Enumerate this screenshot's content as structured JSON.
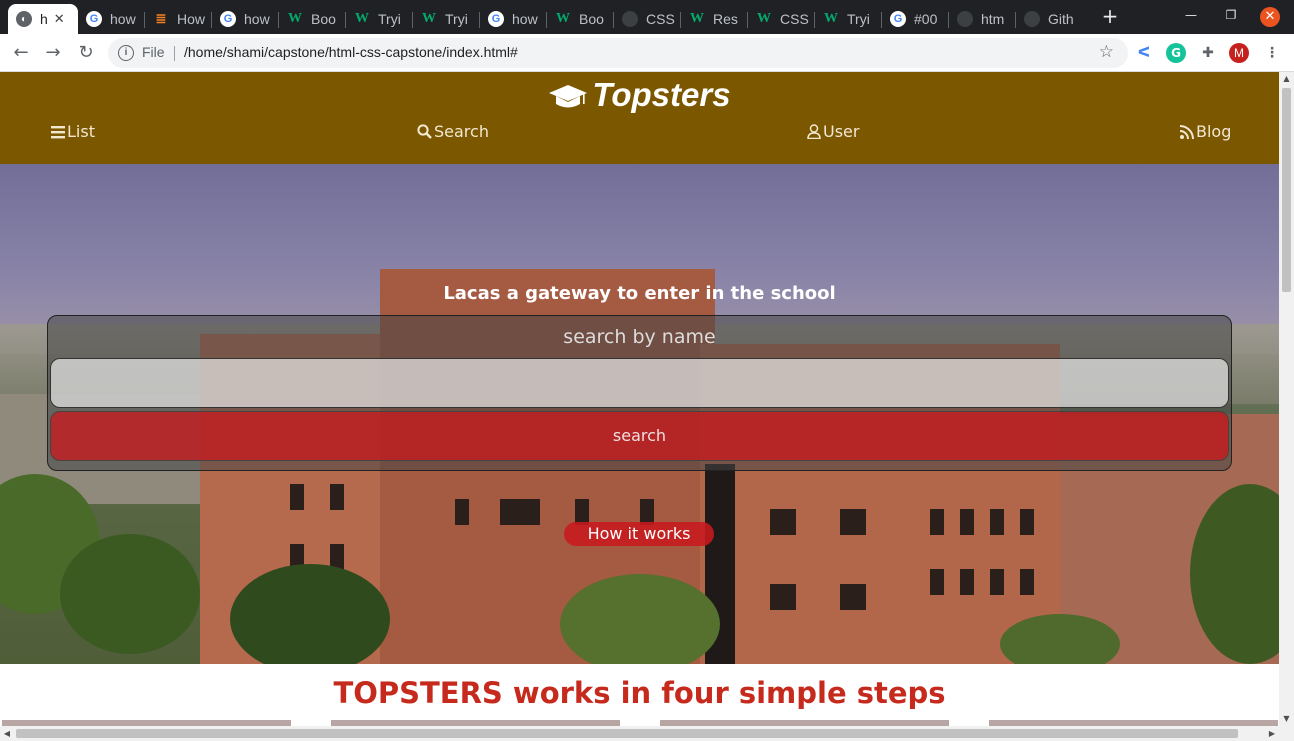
{
  "browser": {
    "tabs": [
      {
        "label": "h",
        "favicon": "globe-icon",
        "active": true
      },
      {
        "label": "how",
        "favicon": "google-icon"
      },
      {
        "label": "How",
        "favicon": "stackoverflow-icon"
      },
      {
        "label": "how",
        "favicon": "google-icon"
      },
      {
        "label": "Boo",
        "favicon": "w3schools-icon"
      },
      {
        "label": "Tryi",
        "favicon": "w3schools-icon"
      },
      {
        "label": "Tryi",
        "favicon": "w3schools-icon"
      },
      {
        "label": "how",
        "favicon": "google-icon"
      },
      {
        "label": "Boo",
        "favicon": "w3schools-icon"
      },
      {
        "label": "CSS",
        "favicon": "github-icon"
      },
      {
        "label": "Res",
        "favicon": "w3schools-icon"
      },
      {
        "label": "CSS",
        "favicon": "w3schools-icon"
      },
      {
        "label": "Tryi",
        "favicon": "w3schools-icon"
      },
      {
        "label": "#00",
        "favicon": "google-icon"
      },
      {
        "label": "htm",
        "favicon": "dark-icon"
      },
      {
        "label": "Gith",
        "favicon": "github-icon"
      }
    ],
    "address": {
      "scheme_label": "File",
      "url": "/home/shami/capstone/html-css-capstone/index.html#"
    },
    "avatar_letter": "M",
    "grammarly_letter": "G"
  },
  "site": {
    "brand": "Topsters",
    "nav": [
      {
        "label": "List",
        "icon": "bars-icon"
      },
      {
        "label": "Search",
        "icon": "search-icon"
      },
      {
        "label": "User",
        "icon": "user-icon"
      },
      {
        "label": "Blog",
        "icon": "rss-icon"
      }
    ],
    "hero": {
      "title": "Lacas a gateway to enter in the school",
      "search_label": "search by name",
      "search_value": "",
      "search_button": "search",
      "how_button": "How it works"
    },
    "steps_title": "TOPSTERS works in four simple steps"
  },
  "colors": {
    "header_bg": "#7b5700",
    "accent_red": "#c52a1c",
    "button_red": "#c8191e"
  }
}
